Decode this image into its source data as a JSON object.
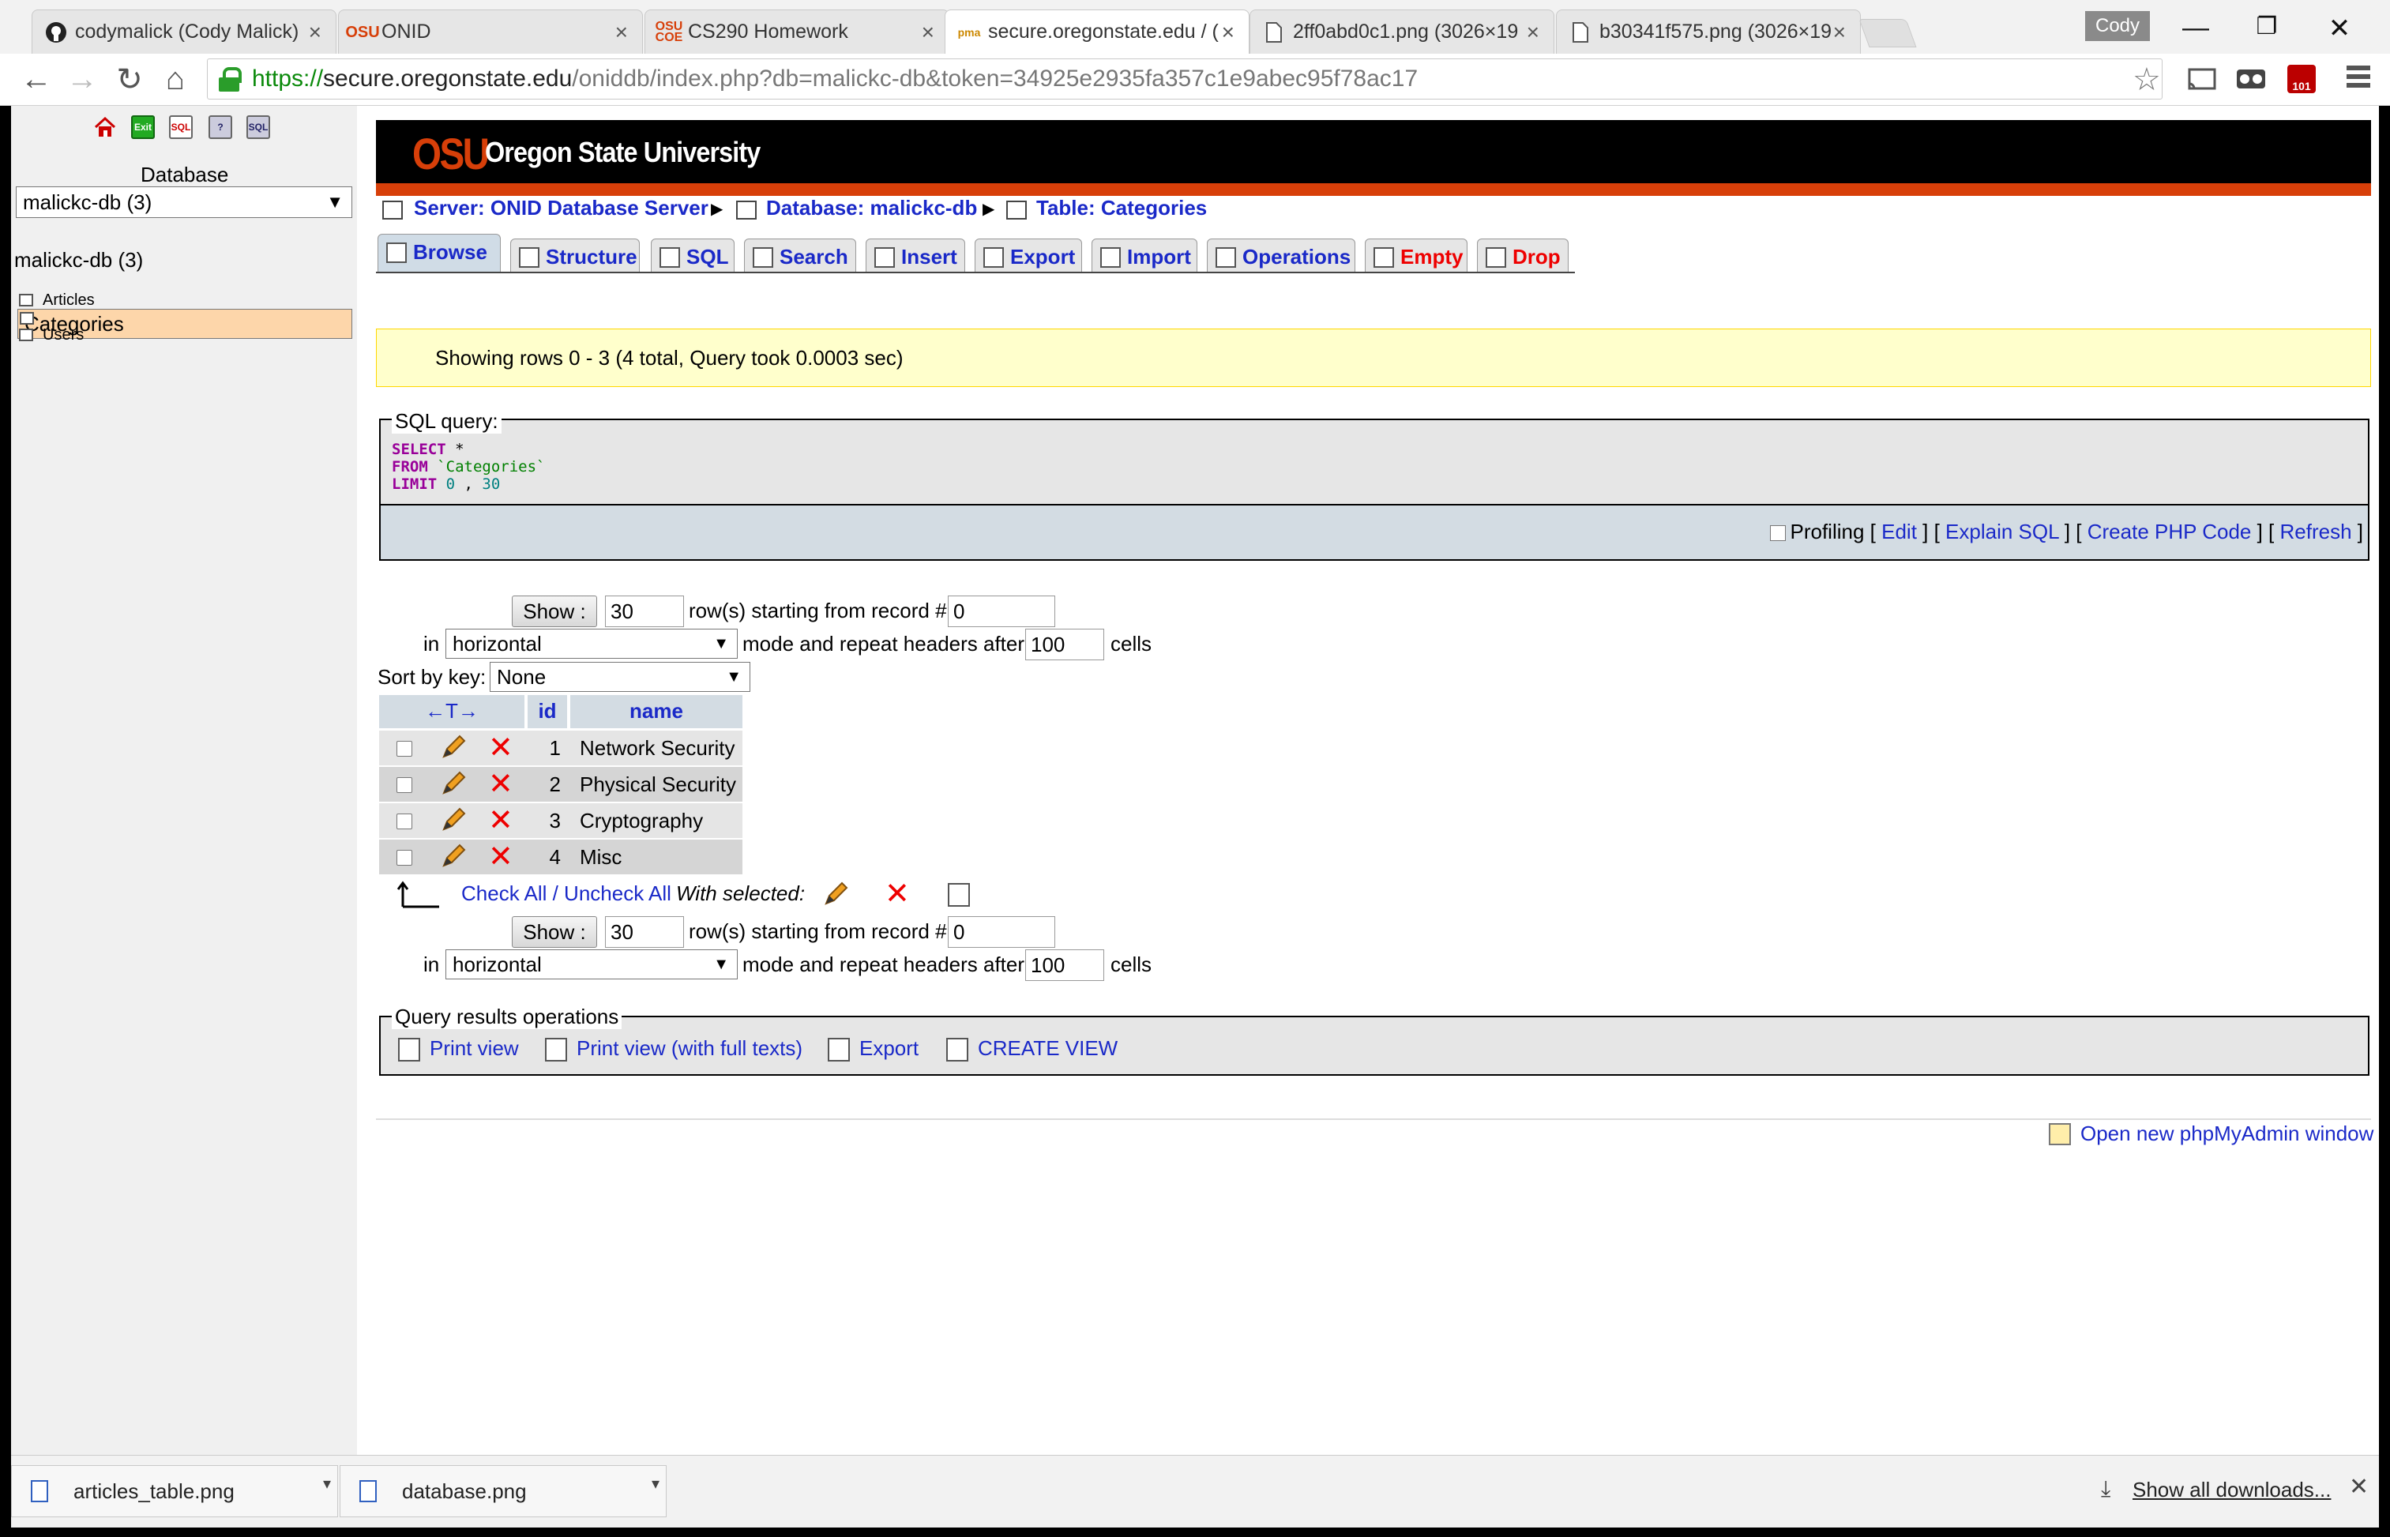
{
  "browser": {
    "tabs": [
      {
        "label": "codymalick (Cody Malick)",
        "icon": "github-icon",
        "active": false
      },
      {
        "label": "ONID",
        "icon": "osu-icon",
        "active": false
      },
      {
        "label": "CS290 Homework",
        "icon": "osu-coe-icon",
        "active": false
      },
      {
        "label": "secure.oregonstate.edu / (",
        "icon": "phpmyadmin-icon",
        "active": true
      },
      {
        "label": "2ff0abd0c1.png (3026×19",
        "icon": "file-icon",
        "active": false
      },
      {
        "label": "b30341f575.png (3026×19",
        "icon": "file-icon",
        "active": false
      }
    ],
    "profile": "Cody",
    "url_scheme": "https://",
    "url_host": "secure.oregonstate.edu",
    "url_path": "/oniddb/index.php?db=malickc-db&token=34925e2935fa357c1e9abec95f78ac17"
  },
  "sidebar": {
    "database_label": "Database",
    "database_selected": "malickc-db (3)",
    "database_heading": "malickc-db (3)",
    "tables": [
      "Articles",
      "Categories",
      "Users"
    ],
    "selected_table": "Categories"
  },
  "header": {
    "logo": "OSU",
    "university": "Oregon State University"
  },
  "breadcrumb": {
    "server": "Server: ONID Database Server",
    "database": "Database: malickc-db",
    "table": "Table: Categories"
  },
  "tabs": [
    {
      "label": "Browse",
      "icon": "browse-icon"
    },
    {
      "label": "Structure",
      "icon": "structure-icon"
    },
    {
      "label": "SQL",
      "icon": "sql-icon"
    },
    {
      "label": "Search",
      "icon": "search-icon"
    },
    {
      "label": "Insert",
      "icon": "insert-icon"
    },
    {
      "label": "Export",
      "icon": "export-icon"
    },
    {
      "label": "Import",
      "icon": "import-icon"
    },
    {
      "label": "Operations",
      "icon": "operations-icon"
    },
    {
      "label": "Empty",
      "icon": "empty-icon"
    },
    {
      "label": "Drop",
      "icon": "drop-icon"
    }
  ],
  "notice": "Showing rows 0 - 3 (4 total, Query took 0.0003 sec)",
  "sql": {
    "legend": "SQL query:",
    "select_kw": "SELECT",
    "select_rest": " *",
    "from_kw": "FROM",
    "from_rest": " `Categories`",
    "limit_kw": "LIMIT",
    "limit_a": " 0",
    "limit_sep": " , ",
    "limit_b": "30",
    "profiling": "Profiling",
    "edit": "Edit",
    "explain": "Explain SQL",
    "php": "Create PHP Code",
    "refresh": "Refresh"
  },
  "nav": {
    "show_label": "Show :",
    "rows_value": "30",
    "starting_text": "row(s) starting from record #",
    "start_value": "0",
    "in_label": "in",
    "mode_value": "horizontal",
    "mode_text": "mode and repeat headers after",
    "repeat_value": "100",
    "cells_text": "cells",
    "sort_label": "Sort by key:",
    "sort_value": "None"
  },
  "table": {
    "columns": [
      "id",
      "name"
    ],
    "arrows": "←T→",
    "rows": [
      {
        "id": "1",
        "name": "Network Security"
      },
      {
        "id": "2",
        "name": "Physical Security"
      },
      {
        "id": "3",
        "name": "Cryptography"
      },
      {
        "id": "4",
        "name": "Misc"
      }
    ],
    "check_all": "Check All / Uncheck All",
    "with_selected": "With selected:"
  },
  "query_ops": {
    "legend": "Query results operations",
    "print_view": "Print view",
    "print_view_full": "Print view (with full texts)",
    "export": "Export",
    "create_view": "CREATE VIEW"
  },
  "footer": {
    "open_window": "Open new phpMyAdmin window"
  },
  "downloads": {
    "items": [
      "articles_table.png",
      "database.png"
    ],
    "show_all": "Show all downloads..."
  },
  "colors": {
    "osu_orange": "#d73f09",
    "link_blue": "#1a29c8",
    "header_grey": "#d3dce3",
    "danger_red": "#e00000"
  }
}
